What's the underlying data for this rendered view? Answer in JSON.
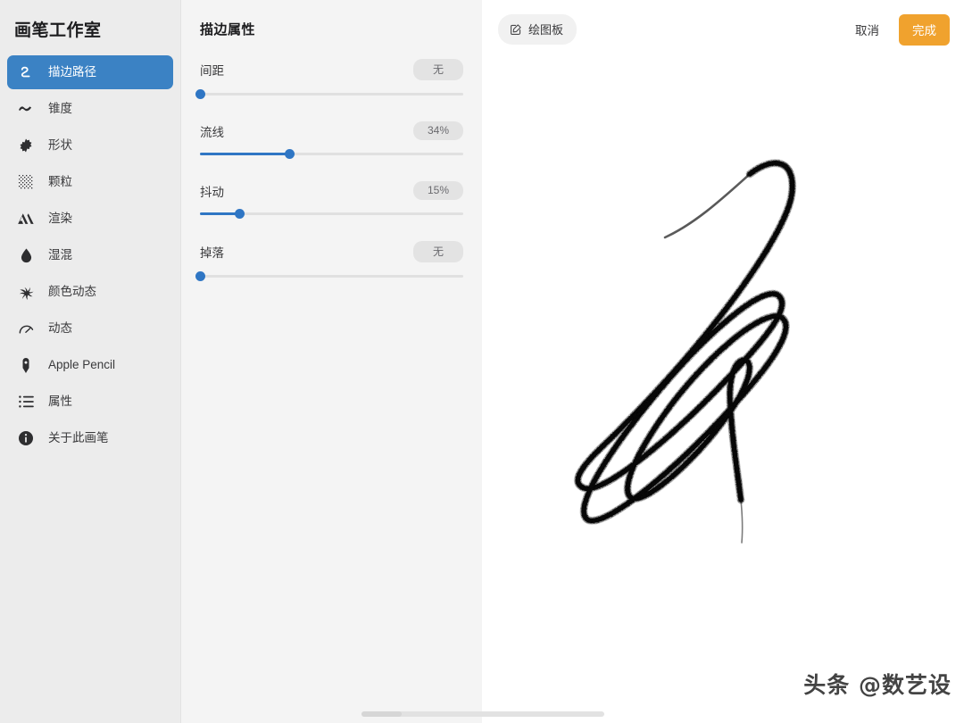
{
  "sidebar": {
    "title": "画笔工作室",
    "items": [
      {
        "label": "描边路径",
        "icon": "stroke-path-icon",
        "selected": true
      },
      {
        "label": "锥度",
        "icon": "taper-wave-icon",
        "selected": false
      },
      {
        "label": "形状",
        "icon": "shape-burst-icon",
        "selected": false
      },
      {
        "label": "颗粒",
        "icon": "grain-icon",
        "selected": false
      },
      {
        "label": "渲染",
        "icon": "render-icon",
        "selected": false
      },
      {
        "label": "湿混",
        "icon": "wet-mix-drop-icon",
        "selected": false
      },
      {
        "label": "颜色动态",
        "icon": "color-dynamics-icon",
        "selected": false
      },
      {
        "label": "动态",
        "icon": "dynamics-gauge-icon",
        "selected": false
      },
      {
        "label": "Apple Pencil",
        "icon": "apple-pencil-icon",
        "selected": false
      },
      {
        "label": "属性",
        "icon": "properties-list-icon",
        "selected": false
      },
      {
        "label": "关于此画笔",
        "icon": "info-circle-icon",
        "selected": false
      }
    ]
  },
  "properties": {
    "title": "描边属性",
    "sliders": [
      {
        "label": "间距",
        "value_text": "无",
        "percent": 0
      },
      {
        "label": "流线",
        "value_text": "34%",
        "percent": 34
      },
      {
        "label": "抖动",
        "value_text": "15%",
        "percent": 15
      },
      {
        "label": "掉落",
        "value_text": "无",
        "percent": 0
      }
    ]
  },
  "toolbar": {
    "drawpad_label": "绘图板",
    "drawpad_icon": "compose-square-pencil-icon",
    "cancel_label": "取消",
    "done_label": "完成"
  },
  "canvas": {
    "watermark": "头条 @数艺设",
    "stroke_description": "grainy-black-zigzag-brush-stroke"
  },
  "colors": {
    "accent_blue": "#3b82c4",
    "slider_blue": "#2f76c4",
    "done_orange": "#f0a22e",
    "sidebar_bg": "#ececec",
    "panel_bg": "#f4f4f4",
    "canvas_bg": "#ffffff",
    "text_primary": "#1c1c1e",
    "text_secondary": "#3a3a3c"
  }
}
